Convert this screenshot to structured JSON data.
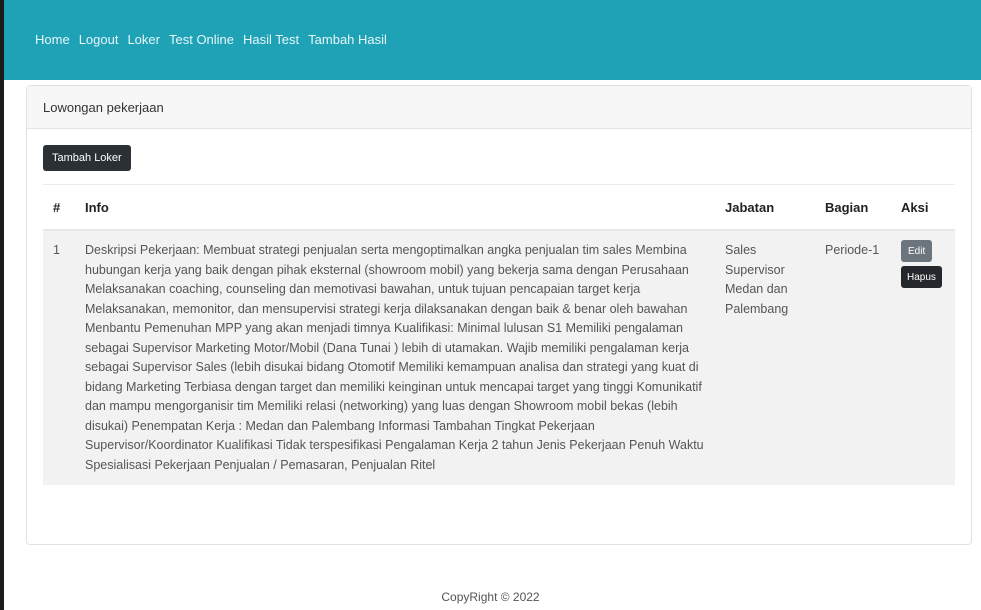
{
  "nav": {
    "links": [
      "Home",
      "Logout",
      "Loker",
      "Test Online",
      "Hasil Test",
      "Tambah Hasil"
    ]
  },
  "card": {
    "header": "Lowongan pekerjaan",
    "add_button": "Tambah Loker"
  },
  "table": {
    "headers": {
      "num": "#",
      "info": "Info",
      "jabatan": "Jabatan",
      "bagian": "Bagian",
      "aksi": "Aksi"
    },
    "rows": [
      {
        "num": "1",
        "info": "Deskripsi Pekerjaan: Membuat strategi penjualan serta mengoptimalkan angka penjualan tim sales Membina hubungan kerja yang baik dengan pihak eksternal (showroom mobil) yang bekerja sama dengan Perusahaan Melaksanakan coaching, counseling dan memotivasi bawahan, untuk tujuan pencapaian target kerja Melaksanakan, memonitor, dan mensupervisi strategi kerja dilaksanakan dengan baik & benar oleh bawahan Menbantu Pemenuhan MPP yang akan menjadi timnya Kualifikasi: Minimal lulusan S1 Memiliki pengalaman sebagai Supervisor Marketing Motor/Mobil (Dana Tunai ) lebih di utamakan. Wajib memiliki pengalaman kerja sebagai Supervisor Sales (lebih disukai bidang Otomotif Memiliki kemampuan analisa dan strategi yang kuat di bidang Marketing Terbiasa dengan target dan memiliki keinginan untuk mencapai target yang tinggi Komunikatif dan mampu mengorganisir tim Memiliki relasi (networking) yang luas dengan Showroom mobil bekas (lebih disukai) Penempatan Kerja : Medan dan Palembang Informasi Tambahan Tingkat Pekerjaan Supervisor/Koordinator Kualifikasi Tidak terspesifikasi Pengalaman Kerja 2 tahun Jenis Pekerjaan Penuh Waktu Spesialisasi Pekerjaan Penjualan / Pemasaran, Penjualan Ritel",
        "jabatan": "Sales Supervisor Medan dan Palembang",
        "bagian": "Periode-1",
        "edit": "Edit",
        "hapus": "Hapus"
      }
    ]
  },
  "footer": "CopyRight © 2022"
}
